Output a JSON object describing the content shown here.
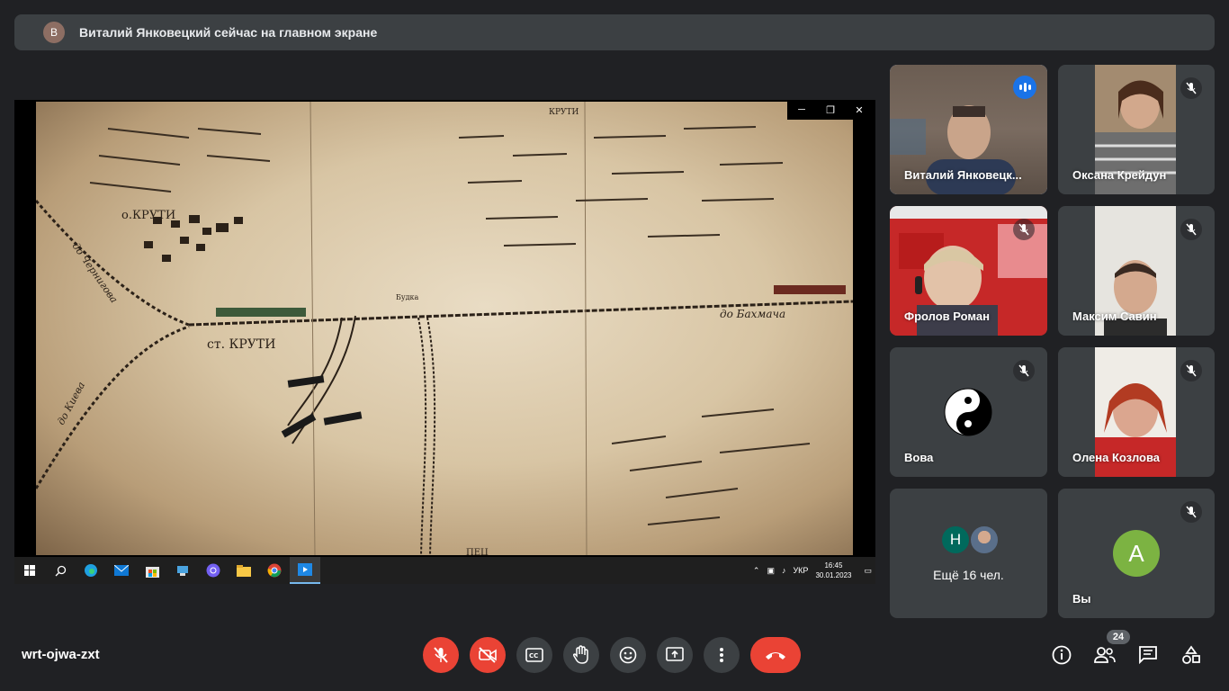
{
  "banner": {
    "avatar_letter": "В",
    "text": "Виталий Янковецкий сейчас на главном экране"
  },
  "presentation": {
    "map_labels": {
      "village": "о.КРУТИ",
      "station": "ст. КРУТИ",
      "to_bakhmach": "до Бахмача",
      "to_chernigov": "до Чернигова",
      "to_kiev": "до Киева",
      "kruty_top": "КРУТИ",
      "budka": "Будка",
      "bottom": "ПЕЦ"
    },
    "taskbar": {
      "lang": "УКР",
      "time": "16:45",
      "date": "30.01.2023"
    }
  },
  "participants": [
    {
      "name": "Виталий Янковецк...",
      "speaking": true
    },
    {
      "name": "Оксана Крейдун",
      "muted": true
    },
    {
      "name": "Фролов Роман",
      "muted": true
    },
    {
      "name": "Максим Савин",
      "muted": true
    },
    {
      "name": "Вова",
      "muted": true
    },
    {
      "name": "Олена Козлова",
      "muted": true
    },
    {
      "name": "Ещё 16 чел.",
      "initial": "Н"
    },
    {
      "name": "Вы",
      "initial": "А",
      "muted": true
    }
  ],
  "colors": {
    "mic_red": "#ea4335",
    "accent_blue": "#1a73e8",
    "you_avatar": "#7cb342",
    "others_avatar": "#00695c"
  },
  "bottom_bar": {
    "meeting_code": "wrt-ojwa-zxt",
    "participant_count": "24"
  }
}
